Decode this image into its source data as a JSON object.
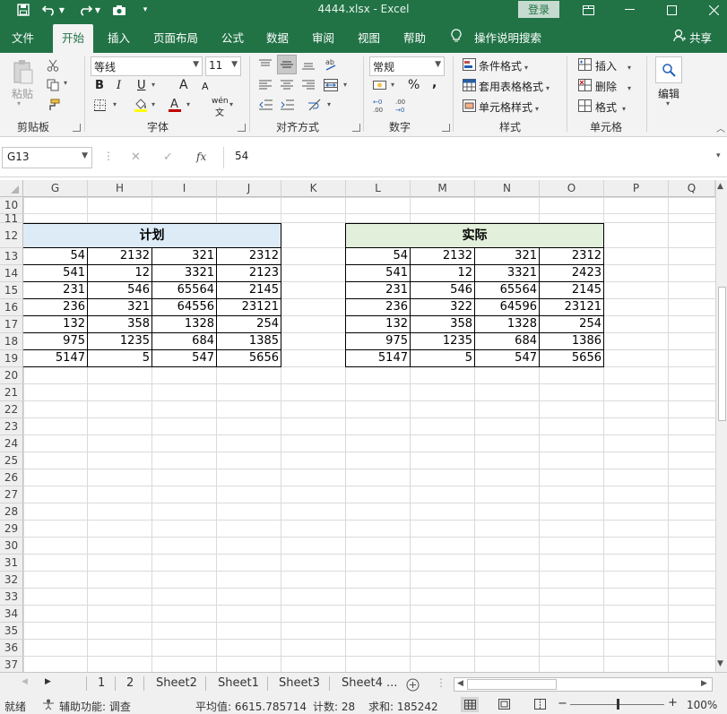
{
  "titlebar": {
    "title": "4444.xlsx  -  Excel",
    "login": "登录"
  },
  "tabs": [
    "文件",
    "开始",
    "插入",
    "页面布局",
    "公式",
    "数据",
    "审阅",
    "视图",
    "帮助",
    "操作说明搜索",
    "共享"
  ],
  "ribbon": {
    "clipboard": {
      "paste": "粘贴",
      "label": "剪贴板"
    },
    "font": {
      "name": "等线",
      "size": "11",
      "bold": "B",
      "italic": "I",
      "underline": "U",
      "grow": "A",
      "shrink": "A",
      "phonetic": "wén",
      "label": "字体"
    },
    "alignment": {
      "label": "对齐方式"
    },
    "number": {
      "format": "常规",
      "percent": "%",
      "comma": ",",
      "label": "数字"
    },
    "styles": {
      "conditional": "条件格式",
      "table": "套用表格格式",
      "cell": "单元格样式",
      "label": "样式"
    },
    "cells": {
      "insert": "插入",
      "delete": "删除",
      "format": "格式",
      "label": "单元格"
    },
    "editing": {
      "label": "编辑"
    }
  },
  "formula_bar": {
    "name_box": "G13",
    "cancel": "✕",
    "enter": "✓",
    "fx": "fx",
    "value": "54"
  },
  "columns": [
    "G",
    "H",
    "I",
    "J",
    "K",
    "L",
    "M",
    "N",
    "O",
    "P",
    "Q"
  ],
  "rows": [
    "10",
    "11",
    "12",
    "13",
    "14",
    "15",
    "16",
    "17",
    "18",
    "19",
    "20",
    "21",
    "22",
    "23",
    "24",
    "25",
    "26",
    "27",
    "28",
    "29",
    "30",
    "31",
    "32",
    "33",
    "34",
    "35",
    "36",
    "37"
  ],
  "plan_table": {
    "header": "计划",
    "header_color": "#ddebf7",
    "rows": [
      [
        "54",
        "2132",
        "321",
        "2312"
      ],
      [
        "541",
        "12",
        "3321",
        "2123"
      ],
      [
        "231",
        "546",
        "65564",
        "2145"
      ],
      [
        "236",
        "321",
        "64556",
        "23121"
      ],
      [
        "132",
        "358",
        "1328",
        "254"
      ],
      [
        "975",
        "1235",
        "684",
        "1385"
      ],
      [
        "5147",
        "5",
        "547",
        "5656"
      ]
    ]
  },
  "actual_table": {
    "header": "实际",
    "header_color": "#e2efda",
    "rows": [
      [
        "54",
        "2132",
        "321",
        "2312"
      ],
      [
        "541",
        "12",
        "3321",
        "2423"
      ],
      [
        "231",
        "546",
        "65564",
        "2145"
      ],
      [
        "236",
        "322",
        "64596",
        "23121"
      ],
      [
        "132",
        "358",
        "1328",
        "254"
      ],
      [
        "975",
        "1235",
        "684",
        "1386"
      ],
      [
        "5147",
        "5",
        "547",
        "5656"
      ]
    ]
  },
  "sheets": [
    "1",
    "2",
    "Sheet2",
    "Sheet1",
    "Sheet3",
    "Sheet4 ..."
  ],
  "statusbar": {
    "ready": "就绪",
    "accessibility": "辅助功能: 调查",
    "average": "平均值: 6615.785714",
    "count": "计数: 28",
    "sum": "求和: 185242",
    "zoom": "100%"
  },
  "colors": {
    "brand": "#217346",
    "ribbon_bg": "#f3f3f3"
  }
}
